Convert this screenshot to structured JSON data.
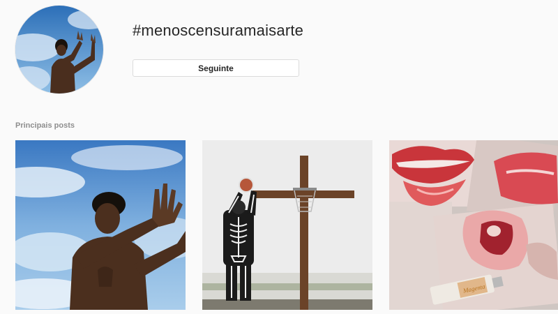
{
  "hashtag": {
    "title": "#menoscensuramaisarte",
    "follow_label": "Seguinte"
  },
  "top_posts": {
    "heading": "Principais posts"
  },
  "colors": {
    "background": "#fafafa",
    "text": "#262626",
    "muted": "#8e8e8e",
    "border": "#dbdbdb"
  }
}
